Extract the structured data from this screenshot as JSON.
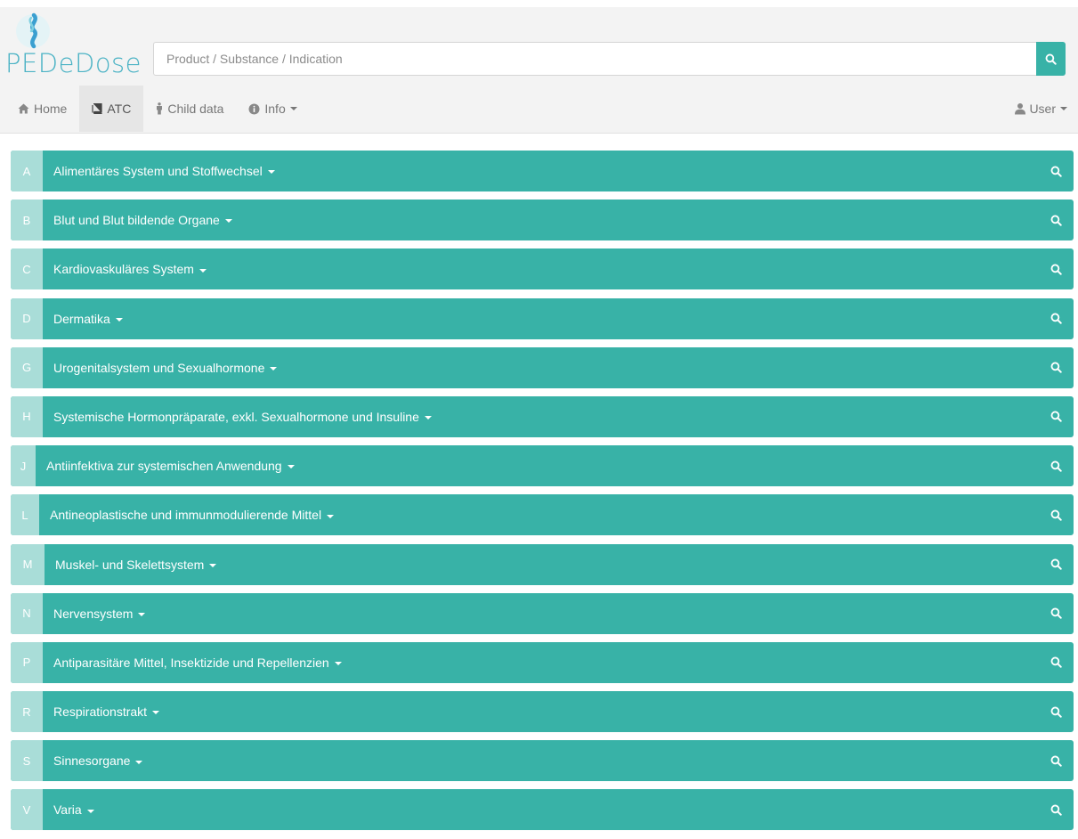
{
  "logo": {
    "text": "PEDeDose"
  },
  "search": {
    "placeholder": "Product / Substance / Indication"
  },
  "nav": {
    "items": [
      {
        "label": "Home",
        "icon": "home-icon"
      },
      {
        "label": "ATC",
        "icon": "book-icon",
        "active": true
      },
      {
        "label": "Child data",
        "icon": "child-icon"
      },
      {
        "label": "Info",
        "icon": "info-icon",
        "dropdown": true
      }
    ],
    "user": {
      "label": "User",
      "icon": "user-icon",
      "dropdown": true
    }
  },
  "atc": [
    {
      "letter": "A",
      "label": "Alimentäres System und Stoffwechsel"
    },
    {
      "letter": "B",
      "label": "Blut und Blut bildende Organe"
    },
    {
      "letter": "C",
      "label": "Kardiovaskuläres System"
    },
    {
      "letter": "D",
      "label": "Dermatika"
    },
    {
      "letter": "G",
      "label": "Urogenitalsystem und Sexualhormone"
    },
    {
      "letter": "H",
      "label": "Systemische Hormonpräparate, exkl. Sexualhormone und Insuline"
    },
    {
      "letter": "J",
      "label": "Antiinfektiva zur systemischen Anwendung"
    },
    {
      "letter": "L",
      "label": "Antineoplastische und immunmodulierende Mittel"
    },
    {
      "letter": "M",
      "label": "Muskel- und Skelettsystem"
    },
    {
      "letter": "N",
      "label": "Nervensystem"
    },
    {
      "letter": "P",
      "label": "Antiparasitäre Mittel, Insektizide und Repellenzien"
    },
    {
      "letter": "R",
      "label": "Respirationstrakt"
    },
    {
      "letter": "S",
      "label": "Sinnesorgane"
    },
    {
      "letter": "V",
      "label": "Varia"
    }
  ],
  "colors": {
    "accent": "#38b2a7",
    "letter_bg": "#a9ddd8",
    "logo_blue": "#4cb3c5",
    "header_bg": "#f3f3f3"
  }
}
